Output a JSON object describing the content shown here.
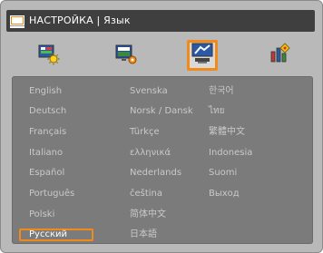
{
  "title": "НАСТРОЙКА | Язык",
  "tabs": [
    {
      "icon": "image-settings-icon",
      "selected": false
    },
    {
      "icon": "display-settings-icon",
      "selected": false
    },
    {
      "icon": "setup-settings-icon",
      "selected": true
    },
    {
      "icon": "options-settings-icon",
      "selected": false
    }
  ],
  "languages": {
    "col1": [
      "English",
      "Deutsch",
      "Français",
      "Italiano",
      "Español",
      "Português",
      "Polski",
      "Русский"
    ],
    "col2": [
      "Svenska",
      "Norsk / Dansk",
      "Türkçe",
      "ελληνικά",
      "Nederlands",
      "čeština",
      "简体中文",
      "日本語"
    ],
    "col3": [
      "한국어",
      "ไทย",
      "繁體中文",
      "Indonesia",
      "Suomi",
      "Выход"
    ]
  },
  "selected_language": "Русский",
  "colors": {
    "accent": "#f28a1a",
    "titlebar": "#3f3f3f",
    "window_bg": "#b9b9b9",
    "panel_bg": "#7b7b7b",
    "text_normal": "#c9c9c9",
    "text_selected": "#ffffff"
  }
}
